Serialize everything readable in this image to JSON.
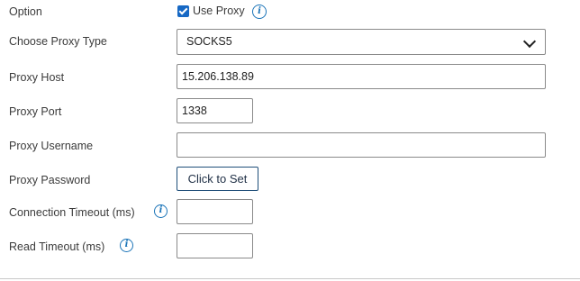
{
  "option": {
    "label": "Option",
    "checkbox_label": "Use Proxy",
    "checked": true
  },
  "proxy_type": {
    "label": "Choose Proxy Type",
    "value": "SOCKS5"
  },
  "proxy_host": {
    "label": "Proxy Host",
    "value": "15.206.138.89"
  },
  "proxy_port": {
    "label": "Proxy Port",
    "value": "1338"
  },
  "proxy_username": {
    "label": "Proxy Username",
    "value": ""
  },
  "proxy_password": {
    "label": "Proxy Password",
    "button_label": "Click to Set"
  },
  "connection_timeout": {
    "label": "Connection Timeout (ms)",
    "value": ""
  },
  "read_timeout": {
    "label": "Read Timeout (ms)",
    "value": ""
  },
  "info_glyph": "i",
  "colors": {
    "accent": "#1668c4",
    "info": "#1b74b8",
    "button_border": "#1f4e79"
  }
}
